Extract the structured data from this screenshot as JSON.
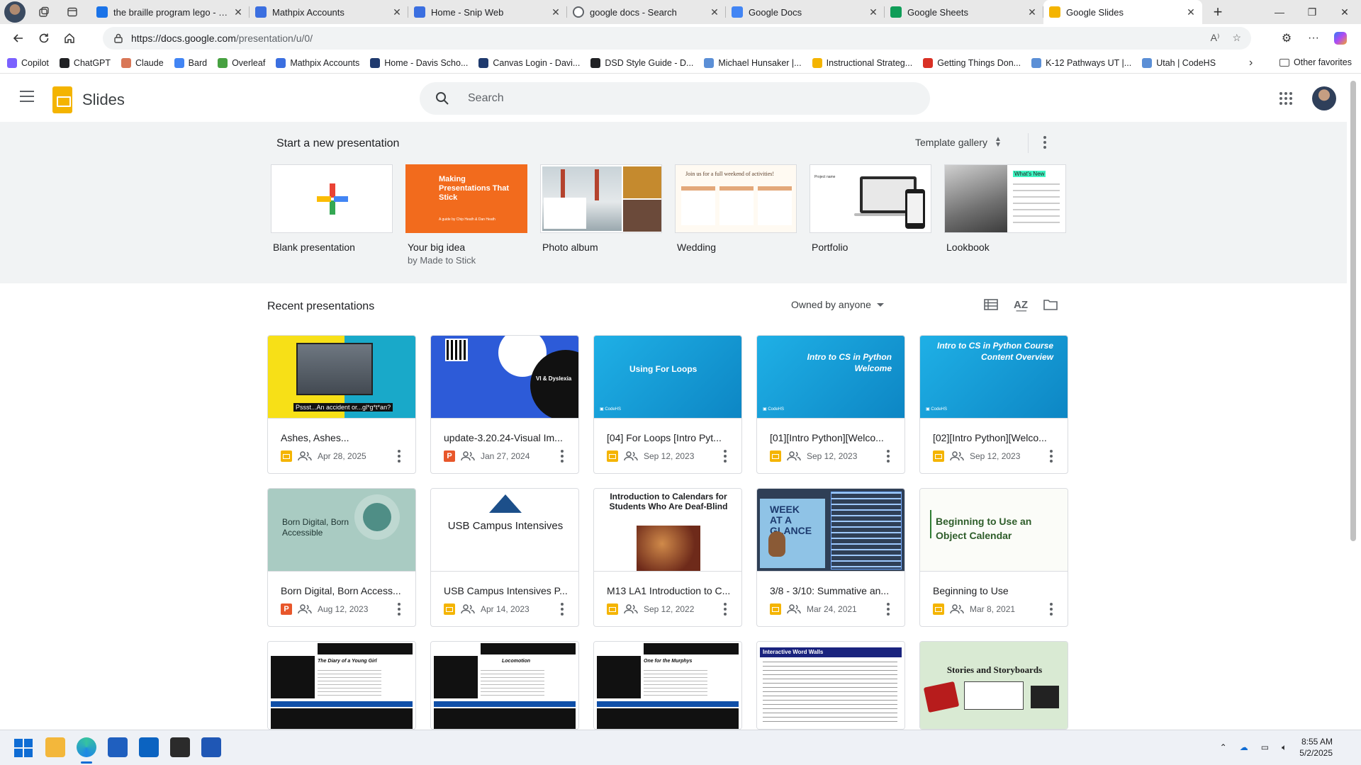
{
  "browser": {
    "tabs": [
      {
        "title": "the braille program lego - Sear",
        "favicon_color": "#1a73e8",
        "active": false
      },
      {
        "title": "Mathpix Accounts",
        "favicon_color": "#3b6fe0",
        "active": false
      },
      {
        "title": "Home - Snip Web",
        "favicon_color": "#3b6fe0",
        "active": false
      },
      {
        "title": "google docs - Search",
        "favicon_color": "#5f6368",
        "active": false
      },
      {
        "title": "Google Docs",
        "favicon_color": "#4285f4",
        "active": false
      },
      {
        "title": "Google Sheets",
        "favicon_color": "#0f9d58",
        "active": false
      },
      {
        "title": "Google Slides",
        "favicon_color": "#f4b400",
        "active": true
      }
    ],
    "url_host": "https://docs.google.com",
    "url_path": "/presentation/u/0/",
    "bookmarks": [
      {
        "label": "Copilot",
        "color": "#7b61ff"
      },
      {
        "label": "ChatGPT",
        "color": "#202124"
      },
      {
        "label": "Claude",
        "color": "#d97757"
      },
      {
        "label": "Bard",
        "color": "#4285f4"
      },
      {
        "label": "Overleaf",
        "color": "#47a141"
      },
      {
        "label": "Mathpix Accounts",
        "color": "#3b6fe0"
      },
      {
        "label": "Home - Davis Scho...",
        "color": "#1f3a6e"
      },
      {
        "label": "Canvas Login - Davi...",
        "color": "#1f3a6e"
      },
      {
        "label": "DSD Style Guide - D...",
        "color": "#202124"
      },
      {
        "label": "Michael Hunsaker |...",
        "color": "#5b8fd6"
      },
      {
        "label": "Instructional Strateg...",
        "color": "#f4b400"
      },
      {
        "label": "Getting Things Don...",
        "color": "#d93025"
      },
      {
        "label": "K-12 Pathways UT |...",
        "color": "#5b8fd6"
      },
      {
        "label": "Utah | CodeHS",
        "color": "#5b8fd6"
      }
    ],
    "other_favorites": "Other favorites"
  },
  "app": {
    "name": "Slides",
    "search_placeholder": "Search"
  },
  "templates": {
    "heading": "Start a new presentation",
    "gallery_label": "Template gallery",
    "items": [
      {
        "name": "Blank presentation",
        "sub": ""
      },
      {
        "name": "Your big idea",
        "sub": "by Made to Stick",
        "thumb_text": "Making Presentations That Stick",
        "thumb_caption": "A guide by Chip Heath & Dan Heath"
      },
      {
        "name": "Photo album",
        "sub": ""
      },
      {
        "name": "Wedding",
        "sub": "",
        "thumb_text": "Join us for a full weekend of activities!"
      },
      {
        "name": "Portfolio",
        "sub": "",
        "thumb_text": "Project name"
      },
      {
        "name": "Lookbook",
        "sub": "",
        "thumb_text": "What's New"
      }
    ]
  },
  "recent": {
    "heading": "Recent presentations",
    "owner_filter": "Owned by anyone",
    "items": [
      {
        "name": "Ashes, Ashes...",
        "date": "Apr 28, 2025",
        "type": "slides",
        "thumb_text": "Pssst...An accident or...gl*g*t*an?"
      },
      {
        "name": "update-3.20.24-Visual Im...",
        "date": "Jan 27, 2024",
        "type": "ppt",
        "thumb_text": "VI & Dyslexia"
      },
      {
        "name": "[04] For Loops [Intro Pyt...",
        "date": "Sep 12, 2023",
        "type": "slides",
        "thumb_text": "Using For Loops"
      },
      {
        "name": "[01][Intro Python][Welco...",
        "date": "Sep 12, 2023",
        "type": "slides",
        "thumb_text": "Intro to CS in Python Welcome"
      },
      {
        "name": "[02][Intro Python][Welco...",
        "date": "Sep 12, 2023",
        "type": "slides",
        "thumb_text": "Intro to CS in Python Course Content Overview"
      },
      {
        "name": "Born Digital, Born Access...",
        "date": "Aug 12, 2023",
        "type": "ppt",
        "thumb_text": "Born Digital, Born Accessible"
      },
      {
        "name": "USB Campus Intensives P...",
        "date": "Apr 14, 2023",
        "type": "slides",
        "thumb_text": "USB Campus Intensives"
      },
      {
        "name": "M13 LA1 Introduction to C...",
        "date": "Sep 12, 2022",
        "type": "slides",
        "thumb_text": "Introduction to Calendars for Students Who Are Deaf-Blind"
      },
      {
        "name": "3/8 - 3/10: Summative an...",
        "date": "Mar 24, 2021",
        "type": "slides",
        "thumb_text": "WEEK AT A GLANCE"
      },
      {
        "name": "Beginning to Use",
        "date": "Mar 8, 2021",
        "type": "slides",
        "thumb_text": "Beginning to Use an Object Calendar"
      },
      {
        "thumb_text": "The Diary of a Young Girl"
      },
      {
        "thumb_text": "Locomotion"
      },
      {
        "thumb_text": "One for the Murphys"
      },
      {
        "thumb_text": "Interactive Word Walls"
      },
      {
        "thumb_text": "Stories and Storyboards"
      }
    ]
  },
  "taskbar": {
    "time": "8:55 AM",
    "date": "5/2/2025"
  },
  "colors": {
    "slides_yellow": "#f4b400",
    "codehs_blue": "#1a9fd9",
    "ppt_orange": "#e8572b"
  }
}
